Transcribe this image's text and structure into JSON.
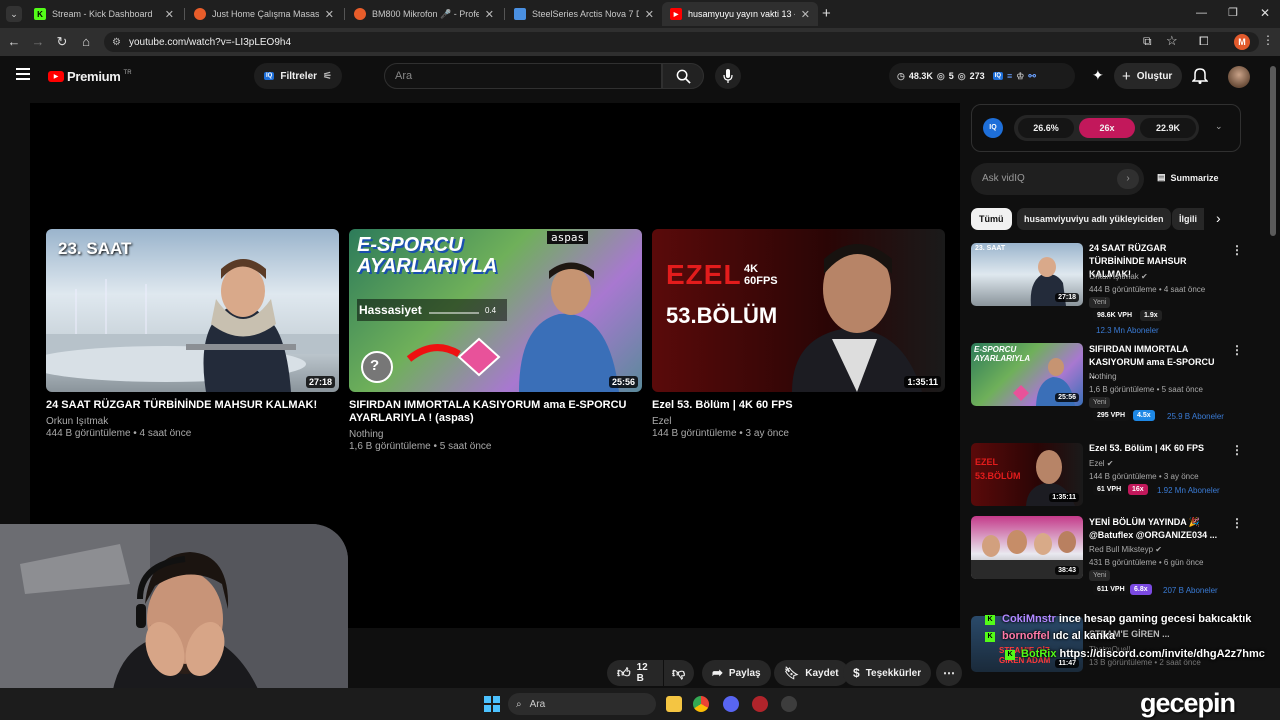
{
  "tabs": [
    {
      "title": "Stream - Kick Dashboard",
      "favicon_color": "#53fc18",
      "active": false
    },
    {
      "title": "Just Home Çalışma Masası - Be",
      "favicon_color": "#e85d2a",
      "active": false
    },
    {
      "title": "BM800 Mikrofon 🎤 - Profesyo",
      "favicon_color": "#e85d2a",
      "active": false
    },
    {
      "title": "SteelSeries Arctis Nova 7 Drago",
      "favicon_color": "#4a90e2",
      "active": false
    },
    {
      "title": "husamyuyu yayın vakti 13 - You",
      "favicon_color": "#ff0000",
      "active": true
    }
  ],
  "browser": {
    "url": "youtube.com/watch?v=-LI3pLEO9h4",
    "profile_initial": "M"
  },
  "youtube": {
    "brand": "Premium",
    "country": "TR",
    "filters_label": "Filtreler",
    "search_placeholder": "Ara",
    "stats": {
      "views": "48.3K",
      "a": "5",
      "b": "273"
    },
    "create_label": "Oluştur"
  },
  "endscreen": [
    {
      "title": "24 SAAT RÜZGAR TÜRBİNİNDE MAHSUR KALMAK!",
      "channel": "Orkun Işıtmak",
      "meta": "444 B görüntüleme • 4 saat önce",
      "duration": "27:18",
      "overlay": "23. SAAT"
    },
    {
      "title": "SIFIRDAN IMMORTALA KASIYORUM ama E-SPORCU AYARLARIYLA ! (aspas)",
      "channel": "Nothing",
      "meta": "1,6 B görüntüleme • 5 saat önce",
      "duration": "25:56",
      "overlay": "E-SPORCU AYARLARIYLA",
      "overlay2": "aspas",
      "overlay3": "Hassasiyet",
      "overlay4": "0.4"
    },
    {
      "title": "Ezel 53. Bölüm | 4K 60 FPS",
      "channel": "Ezel",
      "meta": "144 B görüntüleme • 3 ay önce",
      "duration": "1:35:11",
      "overlay": "EZEL",
      "overlay2": "4K 60FPS",
      "overlay3": "53.BÖLÜM"
    }
  ],
  "actions": {
    "likes": "12 B",
    "share": "Paylaş",
    "save": "Kaydet",
    "thanks": "Teşekkürler"
  },
  "vidiq": {
    "logo": "IQ",
    "stat1": "26.6%",
    "stat2": "26x",
    "stat3": "22.9K",
    "ask_placeholder": "Ask vidIQ",
    "summarize": "Summarize"
  },
  "chips": [
    "Tümü",
    "husamviyuviyu adlı yükleyiciden",
    "İlgili"
  ],
  "sidebar_videos": [
    {
      "title": "24 SAAT RÜZGAR TÜRBİNİNDE MAHSUR KALMAK!",
      "channel": "Orkun Işıtmak",
      "meta": "444 B görüntüleme • 4 saat önce",
      "new": "Yeni",
      "duration": "27:18",
      "vph": "98.6K VPH",
      "mult": "1.9x",
      "subs": "12.3 Mn Aboneler",
      "thumb_text": "23. SAAT"
    },
    {
      "title": "SIFIRDAN IMMORTALA KASIYORUM ama E-SPORCU ...",
      "channel": "Nothing",
      "meta": "1,6 B görüntüleme • 5 saat önce",
      "new": "Yeni",
      "duration": "25:56",
      "vph": "295 VPH",
      "mult": "4.5x",
      "subs": "25.9 B Aboneler",
      "thumb_text": "E-SPORCU AYARLARIYLA"
    },
    {
      "title": "Ezel 53. Bölüm | 4K 60 FPS",
      "channel": "Ezel",
      "meta": "144 B görüntüleme • 3 ay önce",
      "new": "",
      "duration": "1:35:11",
      "vph": "61 VPH",
      "mult": "16x",
      "subs": "1.92 Mn Aboneler",
      "thumb_text": "EZEL 53.BÖLÜM"
    },
    {
      "title": "YENİ BÖLÜM YAYINDA 🎉 @Batuflex @ORGANIZE034 ...",
      "channel": "Red Bull Miksteyp",
      "meta": "431 B görüntüleme • 6 gün önce",
      "new": "Yeni",
      "duration": "38:43",
      "vph": "611 VPH",
      "mult": "6.8x",
      "subs": "207 B Aboneler",
      "thumb_text": ""
    },
    {
      "title": "STEAM'E GİREN ...",
      "channel": "ThatmOuell",
      "meta": "13 B görüntüleme • 2 saat önce",
      "new": "",
      "duration": "11:47",
      "vph": "",
      "mult": "",
      "subs": "",
      "thumb_text": "STEAM'E GİZ GİREN ADAM"
    }
  ],
  "chat": [
    {
      "user": "CokiMnstr",
      "message": "ince hesap gaming gecesi bakıcaktık",
      "color": "#b388ff"
    },
    {
      "user": "bornoffel",
      "message": "ıdc al kanka",
      "color": "#ff7aa8"
    },
    {
      "user": "BotRix",
      "message": "https://discord.com/invite/dhgA2z7hmc",
      "color": "#53fc18"
    }
  ],
  "taskbar": {
    "search": "Ara",
    "brand_watermark": "gecepin"
  },
  "colors": {
    "yt_red": "#ff0000",
    "vidiq_pink": "#c2185b",
    "vidiq_blue": "#1e6fd9",
    "kick_green": "#53fc18"
  }
}
